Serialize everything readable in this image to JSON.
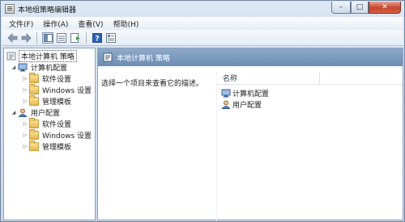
{
  "window": {
    "title": "本地组策略编辑器",
    "controls": {
      "minimize": "–",
      "maximize": "□",
      "close": "✕"
    }
  },
  "menu": [
    {
      "label": "文件(F)"
    },
    {
      "label": "操作(A)"
    },
    {
      "label": "查看(V)"
    },
    {
      "label": "帮助(H)"
    }
  ],
  "toolbar": {
    "buttons": [
      "back-icon",
      "forward-icon",
      "console-tree-icon",
      "show-list-icon",
      "export-list-icon",
      "help-icon",
      "properties-icon"
    ]
  },
  "tree": {
    "root": "本地计算机 策略",
    "computer": {
      "label": "计算机配置",
      "children": [
        "软件设置",
        "Windows 设置",
        "管理模板"
      ]
    },
    "user": {
      "label": "用户配置",
      "children": [
        "软件设置",
        "Windows 设置",
        "管理模板"
      ]
    }
  },
  "details": {
    "header": "本地计算机 策略",
    "description": "选择一个项目来查看它的描述。",
    "column_name": "名称",
    "items": [
      "计算机配置",
      "用户配置"
    ]
  },
  "colors": {
    "title_gradient": "#c8d8eb",
    "header_band": "#7b98bd",
    "close_button": "#c7452c",
    "folder": "#e7b94e"
  }
}
